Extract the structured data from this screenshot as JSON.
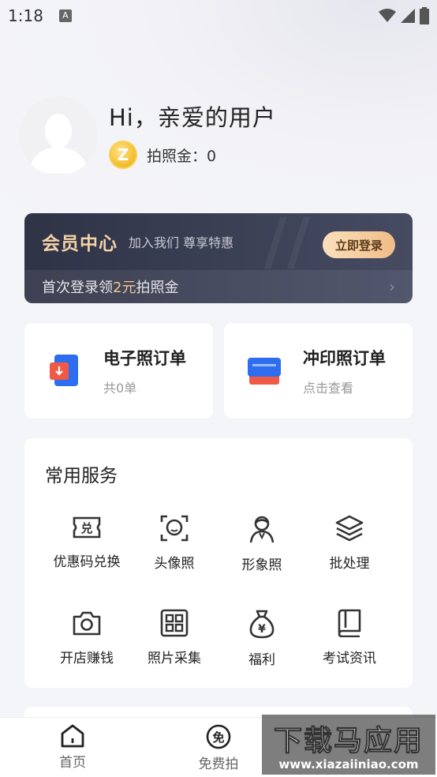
{
  "status_bar": {
    "time": "1:18",
    "notification_letter": "A"
  },
  "profile": {
    "greeting": "Hi，亲爱的用户",
    "coin_symbol": "Z",
    "coin_label": "拍照金：0"
  },
  "member_card": {
    "title": "会员中心",
    "subtitle": "加入我们 尊享特惠",
    "login_button": "立即登录",
    "promo_prefix": "首次登录领",
    "promo_highlight": "2元",
    "promo_suffix": "拍照金"
  },
  "orders": [
    {
      "title": "电子照订单",
      "subtitle": "共0单",
      "icon": "e-photo-order-icon"
    },
    {
      "title": "冲印照订单",
      "subtitle": "点击查看",
      "icon": "print-order-icon"
    }
  ],
  "services": {
    "title": "常用服务",
    "items": [
      {
        "label": "优惠码兑换",
        "icon": "coupon-icon",
        "glyph": "兑"
      },
      {
        "label": "头像照",
        "icon": "avatar-photo-icon"
      },
      {
        "label": "形象照",
        "icon": "image-photo-icon"
      },
      {
        "label": "批处理",
        "icon": "batch-icon"
      },
      {
        "label": "开店赚钱",
        "icon": "camera-icon"
      },
      {
        "label": "照片采集",
        "icon": "photo-collect-icon"
      },
      {
        "label": "福利",
        "icon": "money-bag-icon",
        "glyph": "¥"
      },
      {
        "label": "考试资讯",
        "icon": "book-icon"
      }
    ]
  },
  "bottom_nav": [
    {
      "label": "首页",
      "icon": "home-icon"
    },
    {
      "label": "免费拍",
      "icon": "free-shoot-icon",
      "glyph": "免"
    }
  ],
  "watermark": {
    "main": "下载马应用",
    "url": "www.xiazaiiniao.com"
  },
  "colors": {
    "member_bg": "#2f3346",
    "member_gold": "#f3d3a8",
    "accent_blue": "#2f6df0",
    "accent_red": "#f05a44"
  }
}
